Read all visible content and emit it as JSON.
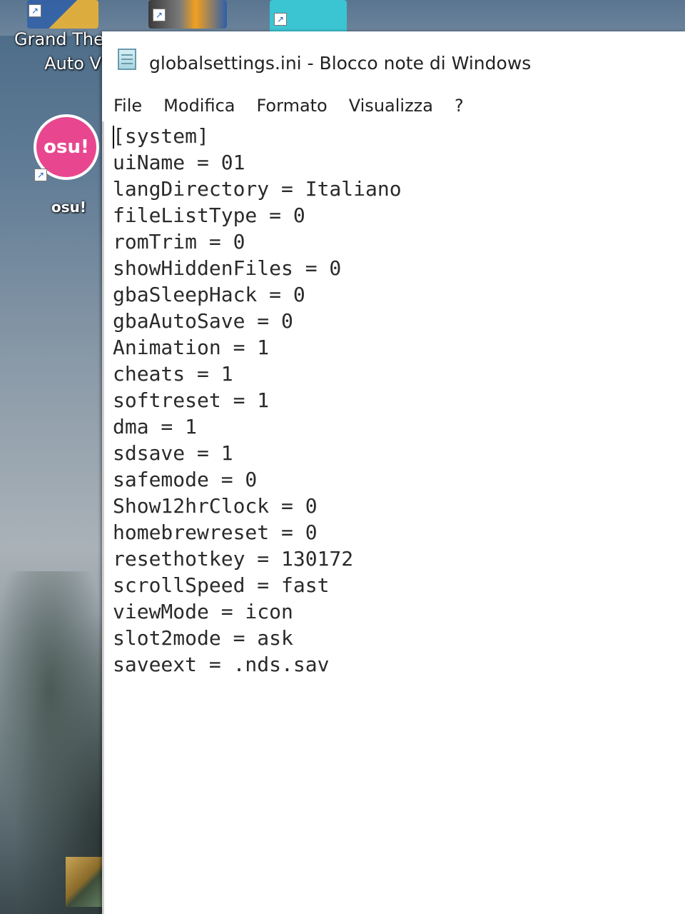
{
  "desktop": {
    "icons": [
      {
        "label_lines": [
          "Grand The",
          "Auto V"
        ],
        "icon": "gta-v-icon"
      },
      {
        "label": "osu!",
        "icon": "osu-icon",
        "icon_text": "osu!"
      }
    ]
  },
  "window": {
    "title": "globalsettings.ini - Blocco note di Windows",
    "menu": [
      "File",
      "Modifica",
      "Formato",
      "Visualizza",
      "?"
    ]
  },
  "editor": {
    "lines": [
      "[system]",
      "uiName = 01",
      "langDirectory = Italiano",
      "fileListType = 0",
      "romTrim = 0",
      "showHiddenFiles = 0",
      "gbaSleepHack = 0",
      "gbaAutoSave = 0",
      "Animation = 1",
      "cheats = 1",
      "softreset = 1",
      "dma = 1",
      "sdsave = 1",
      "safemode = 0",
      "Show12hrClock = 0",
      "homebrewreset = 0",
      "resethotkey = 130172",
      "scrollSpeed = fast",
      "viewMode = icon",
      "slot2mode = ask",
      "saveext = .nds.sav"
    ]
  }
}
